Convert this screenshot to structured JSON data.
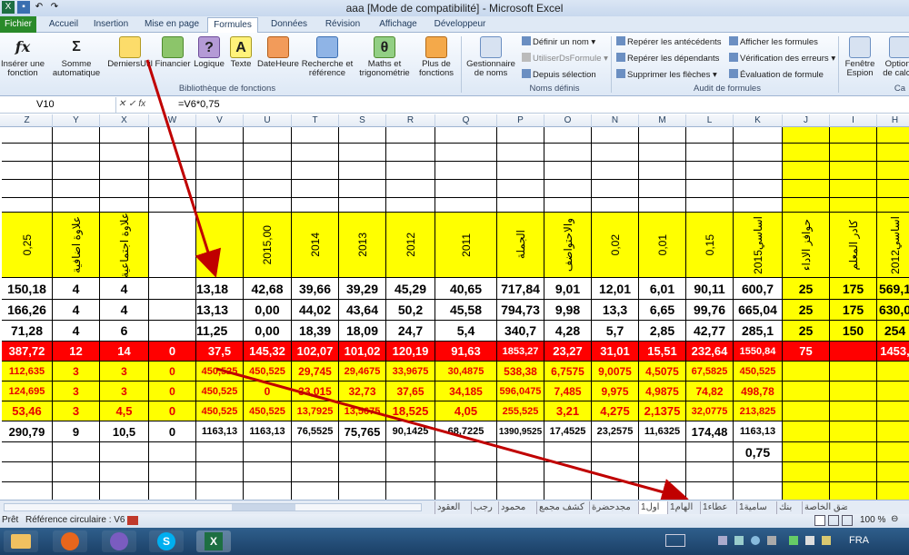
{
  "window": {
    "title": "aaa  [Mode de compatibilité]  -  Microsoft Excel"
  },
  "tabs": [
    "Fichier",
    "Accueil",
    "Insertion",
    "Mise en page",
    "Formules",
    "Données",
    "Révision",
    "Affichage",
    "Développeur"
  ],
  "active_tab": "Formules",
  "ribbon": {
    "insert_function": "Insérer une fonction",
    "autosum": "Somme automatique",
    "recent": "DerniersUtil",
    "financial": "Financier",
    "logical": "Logique",
    "text": "Texte",
    "datetime": "DateHeure",
    "lookup": "Recherche et référence",
    "math": "Maths et trigonométrie",
    "more": "Plus de fonctions",
    "name_manager": "Gestionnaire de noms",
    "define_name": "Définir un nom",
    "use_in_formula": "UtiliserDsFormule",
    "from_selection": "Depuis sélection",
    "trace_precedents": "Repérer les antécédents",
    "trace_dependents": "Repérer les dépendants",
    "remove_arrows": "Supprimer les flèches",
    "show_formulas": "Afficher les formules",
    "error_checking": "Vérification des erreurs",
    "evaluate": "Évaluation de formule",
    "watch_window": "Fenêtre Espion",
    "calc_options": "Options de calcul",
    "group_library": "Bibliothèque de fonctions",
    "group_names": "Noms définis",
    "group_audit": "Audit de formules",
    "group_calc": "Ca"
  },
  "formula_bar": {
    "name_box": "V10",
    "formula": "=V6*0,75"
  },
  "columns": [
    "Z",
    "Y",
    "X",
    "W",
    "V",
    "U",
    "T",
    "S",
    "R",
    "Q",
    "P",
    "O",
    "N",
    "M",
    "L",
    "K",
    "J",
    "I",
    "H"
  ],
  "header_row": [
    "0,25",
    "علاوة اضافية",
    "علاوة اجتماعية",
    "",
    "",
    "2015,00",
    "2014",
    "2013",
    "2012",
    "2011",
    "الجملة",
    "والاحتواضف",
    "0,02",
    "0,01",
    "0,15",
    "اساسي2015",
    "حوافز الاداء",
    "كادر المعلم",
    "اساسي2012"
  ],
  "rows": [
    [
      "150,18",
      "4",
      "4",
      "",
      "13,18",
      "42,68",
      "39,66",
      "39,29",
      "45,29",
      "40,65",
      "717,84",
      "9,01",
      "12,01",
      "6,01",
      "90,11",
      "600,7",
      "25",
      "175",
      "569,1"
    ],
    [
      "166,26",
      "4",
      "4",
      "",
      "13,13",
      "0,00",
      "44,02",
      "43,64",
      "50,2",
      "45,58",
      "794,73",
      "9,98",
      "13,3",
      "6,65",
      "99,76",
      "665,04",
      "25",
      "175",
      "630,0"
    ],
    [
      "71,28",
      "4",
      "6",
      "",
      "11,25",
      "0,00",
      "18,39",
      "18,09",
      "24,7",
      "5,4",
      "340,7",
      "4,28",
      "5,7",
      "2,85",
      "42,77",
      "285,1",
      "25",
      "150",
      "254"
    ],
    [
      "387,72",
      "12",
      "14",
      "0",
      "37,5",
      "145,32",
      "102,07",
      "101,02",
      "120,19",
      "91,63",
      "1853,27",
      "23,27",
      "31,01",
      "15,51",
      "232,64",
      "1550,84",
      "75",
      "",
      "1453,"
    ],
    [
      "112,635",
      "3",
      "3",
      "0",
      "450,525",
      "450,525",
      "29,745",
      "29,4675",
      "33,9675",
      "30,4875",
      "538,38",
      "6,7575",
      "9,0075",
      "4,5075",
      "67,5825",
      "450,525",
      "",
      "",
      ""
    ],
    [
      "124,695",
      "3",
      "3",
      "0",
      "450,525",
      "0",
      "33,015",
      "32,73",
      "37,65",
      "34,185",
      "596,0475",
      "7,485",
      "9,975",
      "4,9875",
      "74,82",
      "498,78",
      "",
      "",
      ""
    ],
    [
      "53,46",
      "3",
      "4,5",
      "0",
      "450,525",
      "450,525",
      "13,7925",
      "13,5675",
      "18,525",
      "4,05",
      "255,525",
      "3,21",
      "4,275",
      "2,1375",
      "32,0775",
      "213,825",
      "",
      "",
      ""
    ],
    [
      "290,79",
      "9",
      "10,5",
      "0",
      "1163,13",
      "1163,13",
      "76,5525",
      "75,765",
      "90,1425",
      "68,7225",
      "1390,9525",
      "17,4525",
      "23,2575",
      "11,6325",
      "174,48",
      "1163,13",
      "",
      "",
      ""
    ],
    [
      "",
      "",
      "",
      "",
      "",
      "",
      "",
      "",
      "",
      "",
      "",
      "",
      "",
      "",
      "",
      "0,75",
      "",
      "",
      ""
    ]
  ],
  "sheets": [
    "العقود",
    "رجب",
    "محمود",
    "كشف مجمع",
    "مجدحضرة",
    "اول1",
    "الهام1",
    "عطاء1",
    "سامية1",
    "بنك",
    "ضق الخاصة"
  ],
  "active_sheet": "اول1",
  "status": {
    "ready": "Prêt",
    "circular": "Référence circulaire : V6",
    "zoom": "100 %"
  },
  "taskbar": {
    "lang": "FRA"
  },
  "colors": {
    "yellow": "#ffff00",
    "red": "#ff0000",
    "redtext": "#e60000",
    "arrow": "#c00000"
  }
}
